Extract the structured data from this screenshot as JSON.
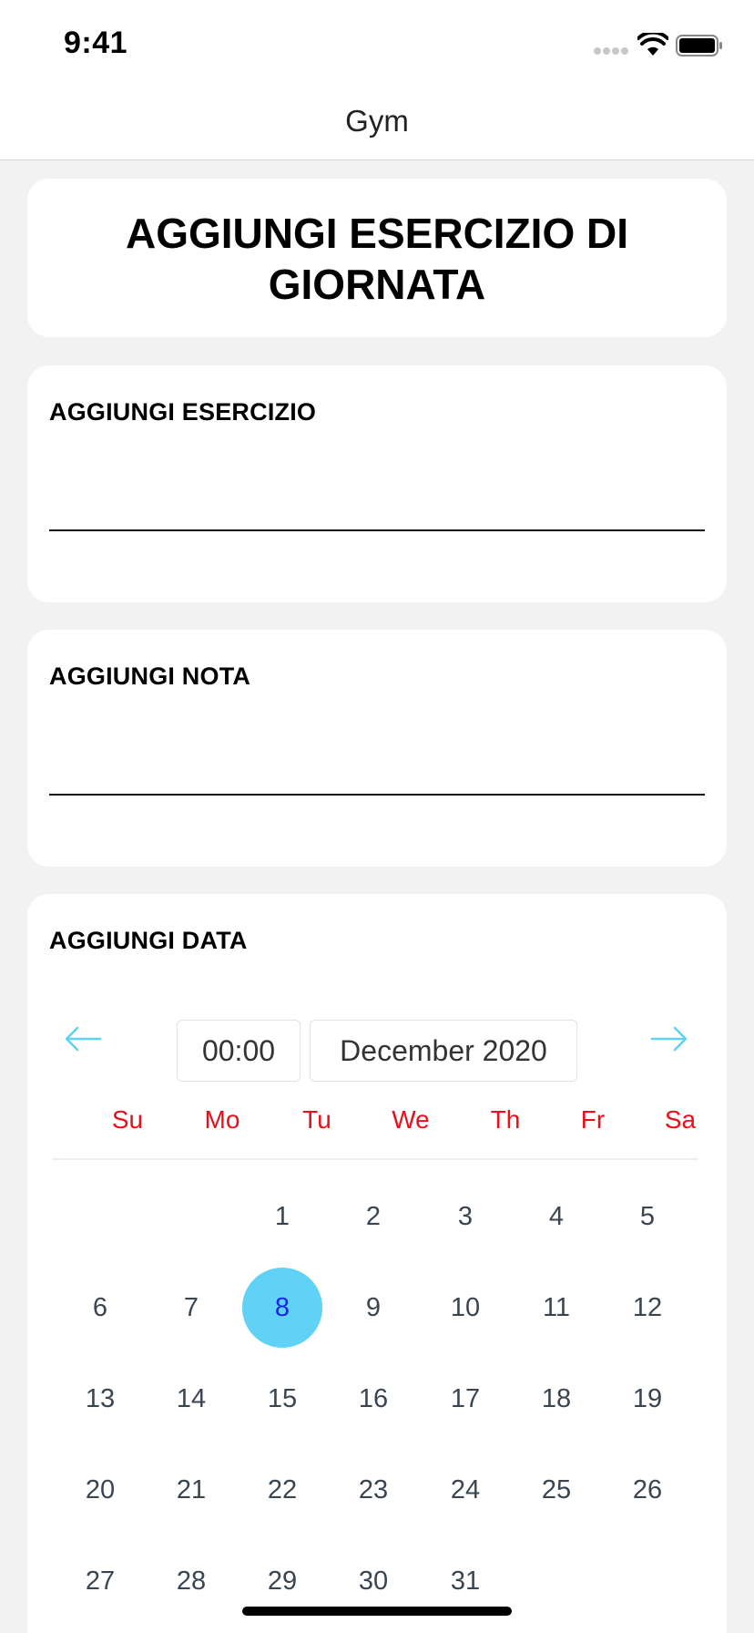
{
  "status_bar": {
    "time": "9:41"
  },
  "nav": {
    "title": "Gym"
  },
  "form": {
    "title": "AGGIUNGI ESERCIZIO DI GIORNATA",
    "exercise_label": "AGGIUNGI ESERCIZIO",
    "exercise_value": "",
    "note_label": "AGGIUNGI NOTA",
    "note_value": "",
    "date_label": "AGGIUNGI DATA"
  },
  "calendar": {
    "time": "00:00",
    "month": "December 2020",
    "weekdays": [
      "Su",
      "Mo",
      "Tu",
      "We",
      "Th",
      "Fr",
      "Sa"
    ],
    "weekday_color": "#e8101a",
    "arrow_color": "#5fd2f5",
    "selected_color": "#5fd2f5",
    "first_weekday_index": 2,
    "days_in_month": 31,
    "selected_day": 8
  }
}
